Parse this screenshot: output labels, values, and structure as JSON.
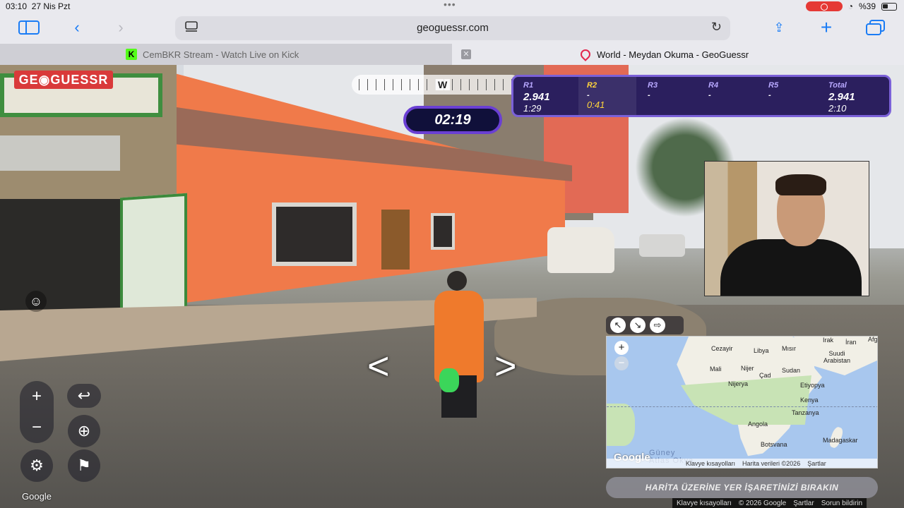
{
  "status": {
    "time": "03:10",
    "date": "27 Nis Pzt",
    "battery": "%39",
    "battery_level": 0.39
  },
  "browser": {
    "url": "geoguessr.com",
    "tabs": [
      {
        "title": "CemBKR Stream - Watch Live on Kick",
        "favicon": "K"
      },
      {
        "title": "World - Meydan Okuma - GeoGuessr"
      }
    ]
  },
  "game": {
    "logo": "GE◉GUESSR",
    "compass_dir": "W",
    "timer": "02:19",
    "rounds": [
      {
        "label": "R1",
        "score": "2.941",
        "time": "1:29"
      },
      {
        "label": "R2",
        "score": "-",
        "time": "0:41"
      },
      {
        "label": "R3",
        "score": "-",
        "time": ""
      },
      {
        "label": "R4",
        "score": "-",
        "time": ""
      },
      {
        "label": "R5",
        "score": "-",
        "time": ""
      },
      {
        "label": "Total",
        "score": "2.941",
        "time": "2:10"
      }
    ],
    "place_button": "HARİTA ÜZERİNE YER İŞARETİNİZİ BIRAKIN",
    "streetview_watermark": "Google"
  },
  "map": {
    "labels": [
      "Cezayir",
      "Libya",
      "Mısır",
      "Irak",
      "İran",
      "Afg",
      "Suudi Arabistan",
      "Mali",
      "Nijer",
      "Sudan",
      "Çad",
      "Nijerya",
      "Etiyopya",
      "Kenya",
      "Tanzanya",
      "Angola",
      "Botsvana",
      "Madagaskar"
    ],
    "ocean": "Güney Atlas Okya",
    "logo": "Google",
    "footer": [
      "Klavye kısayolları",
      "Harita verileri ©2026",
      "Şartlar"
    ]
  },
  "bottom_links": [
    "Klavye kısayolları",
    "© 2026 Google",
    "Şartlar",
    "Sorun bildirin"
  ]
}
